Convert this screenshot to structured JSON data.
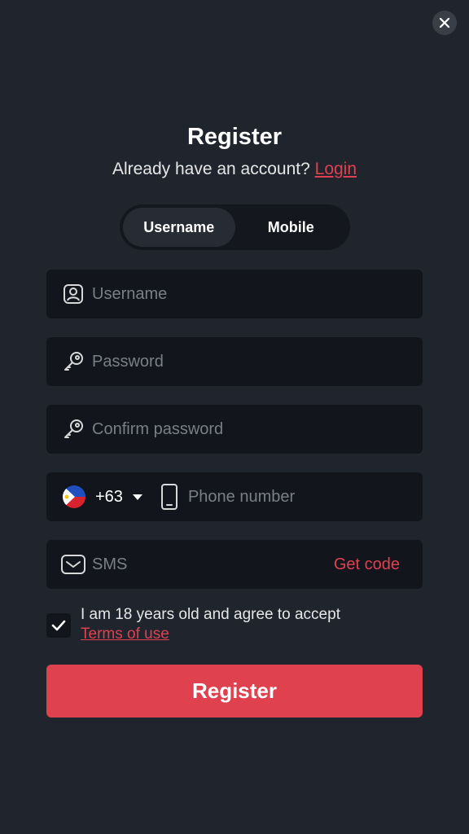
{
  "header": {
    "title": "Register",
    "subtitle_prefix": "Already have an account?",
    "login_link": "Login"
  },
  "tabs": [
    {
      "label": "Username",
      "active": true
    },
    {
      "label": "Mobile",
      "active": false
    }
  ],
  "form": {
    "username_placeholder": "Username",
    "password_placeholder": "Password",
    "confirm_placeholder": "Confirm password",
    "country_code": "+63",
    "phone_placeholder": "Phone number",
    "sms_placeholder": "SMS",
    "get_code_label": "Get code"
  },
  "agreement": {
    "checked": true,
    "text": "I am 18 years old and agree to accept",
    "terms_link": "Terms of use"
  },
  "submit": {
    "label": "Register"
  },
  "icons": {
    "close": "close-icon",
    "username": "user-badge-icon",
    "password": "key-icon",
    "confirm": "key-icon",
    "flag": "philippines-flag-icon",
    "phone": "smartphone-icon",
    "sms": "envelope-icon",
    "check": "checkmark-icon"
  },
  "colors": {
    "background": "#20252d",
    "field": "#12161c",
    "accent": "#e0414f"
  }
}
